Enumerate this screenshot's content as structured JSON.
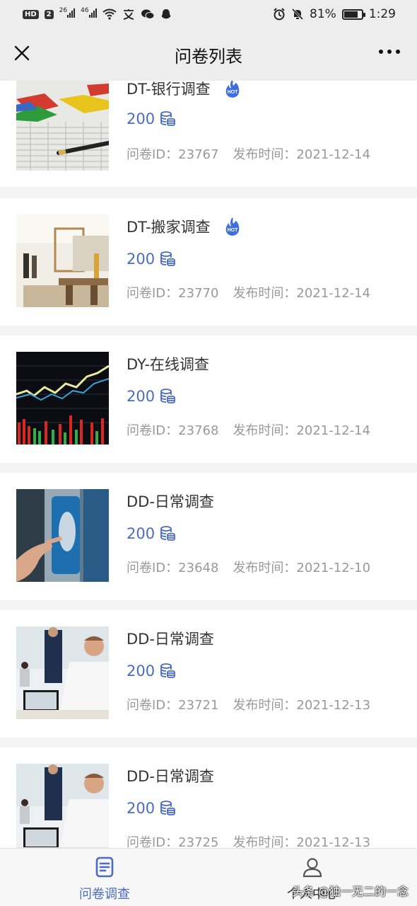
{
  "status_bar": {
    "left_badge": "HD",
    "sim_num": "2",
    "net1": "26",
    "net2": "46",
    "battery_pct": "81%",
    "time": "1:29",
    "battery_level": 0.81
  },
  "nav": {
    "title": "问卷列表",
    "close_icon": "close-icon",
    "more_icon": "more-icon"
  },
  "cards": [
    {
      "title": "DT-银行调查",
      "hot": true,
      "reward": "200",
      "id_label": "问卷ID：23767",
      "date_label": "发布时间：2021-12-14",
      "thumb": "bank-chart-photo"
    },
    {
      "title": "DT-搬家调查",
      "hot": true,
      "reward": "200",
      "id_label": "问卷ID：23770",
      "date_label": "发布时间：2021-12-14",
      "thumb": "office-interior-photo"
    },
    {
      "title": "DY-在线调查",
      "hot": false,
      "reward": "200",
      "id_label": "问卷ID：23768",
      "date_label": "发布时间：2021-12-14",
      "thumb": "stock-chart-photo"
    },
    {
      "title": "DD-日常调查",
      "hot": false,
      "reward": "200",
      "id_label": "问卷ID：23648",
      "date_label": "发布时间：2021-12-10",
      "thumb": "device-hand-photo"
    },
    {
      "title": "DD-日常调查",
      "hot": false,
      "reward": "200",
      "id_label": "问卷ID：23721",
      "date_label": "发布时间：2021-12-13",
      "thumb": "business-meeting-photo"
    },
    {
      "title": "DD-日常调查",
      "hot": false,
      "reward": "200",
      "id_label": "问卷ID：23725",
      "date_label": "发布时间：2021-12-13",
      "thumb": "business-meeting-photo"
    }
  ],
  "hot_badge_text": "HOT",
  "tabs": [
    {
      "label": "问卷调查",
      "icon": "document-icon",
      "active": true
    },
    {
      "label": "个人中心",
      "icon": "user-icon",
      "active": false
    }
  ],
  "watermark": "头条 @独一无二的一念",
  "colors": {
    "accent": "#4a6bc8",
    "hot": "#3d6fe0"
  }
}
